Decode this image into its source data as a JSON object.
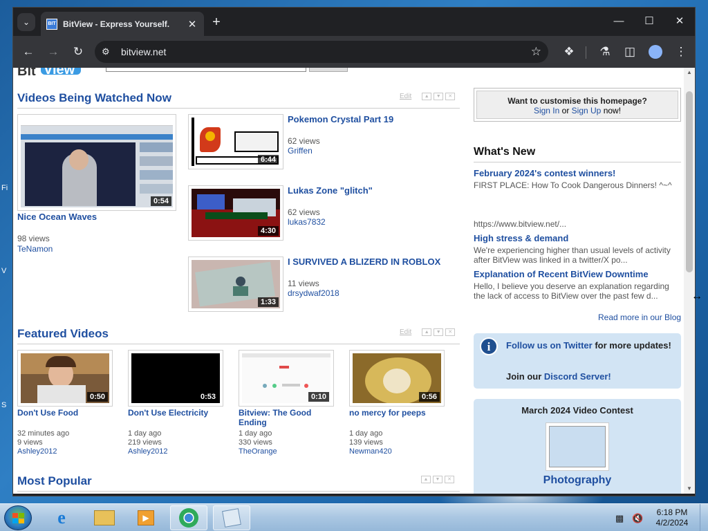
{
  "browser": {
    "tab_title": "BitView - Express Yourself.",
    "favicon_text": "BIT VIEW",
    "url": "bitview.net"
  },
  "icons": {
    "tab_search": "chevron-down-icon",
    "tab_close": "close-icon",
    "new_tab": "plus-icon",
    "minimize": "minimize-icon",
    "maximize": "maximize-icon",
    "close": "close-icon",
    "back": "arrow-left-icon",
    "forward": "arrow-right-icon",
    "reload": "reload-icon",
    "site_info": "tune-icon",
    "bookmark": "star-icon",
    "extensions": "puzzle-icon",
    "labs": "flask-icon",
    "side_panel": "side-panel-icon",
    "profile": "profile-icon",
    "menu": "kebab-menu-icon"
  },
  "header": {
    "logo_bit": "Bit",
    "logo_view": "View"
  },
  "watched": {
    "title": "Videos Being Watched Now",
    "edit": "Edit",
    "featured": {
      "title": "Nice Ocean Waves",
      "duration": "0:54",
      "views": "98 views",
      "user": "TeNamon"
    },
    "list": [
      {
        "title": "Pokemon Crystal Part 19",
        "duration": "6:44",
        "views": "62 views",
        "user": "Griffen"
      },
      {
        "title": "Lukas Zone \"glitch\"",
        "duration": "4:30",
        "views": "62 views",
        "user": "lukas7832"
      },
      {
        "title": "I SURVIVED A BLIZERD IN ROBLOX",
        "duration": "1:33",
        "views": "11 views",
        "user": "drsydwaf2018"
      }
    ]
  },
  "featured_videos": {
    "title": "Featured Videos",
    "edit": "Edit",
    "items": [
      {
        "title": "Don't Use Food",
        "duration": "0:50",
        "time": "32 minutes ago",
        "views": "9 views",
        "user": "Ashley2012"
      },
      {
        "title": "Don't Use Electricity",
        "duration": "0:53",
        "time": "1 day ago",
        "views": "219 views",
        "user": "Ashley2012"
      },
      {
        "title": "Bitview: The Good Ending",
        "duration": "0:10",
        "time": "1 day ago",
        "views": "330 views",
        "user": "TheOrange"
      },
      {
        "title": "no mercy for peeps",
        "duration": "0:56",
        "time": "1 day ago",
        "views": "139 views",
        "user": "Newman420"
      }
    ]
  },
  "most_popular": {
    "title": "Most Popular"
  },
  "sidebar": {
    "customise_question": "Want to customise this homepage?",
    "sign_in": "Sign In",
    "or": "or",
    "sign_up": "Sign Up",
    "now": "now!",
    "whats_new": "What's New",
    "news": [
      {
        "title": "February 2024's contest winners!",
        "body": "FIRST PLACE: How To Cook Dangerous Dinners! ^~^"
      },
      {
        "title": "High stress & demand",
        "body": "We're experiencing higher than usual levels of activity after BitView was linked in a twitter/X po..."
      },
      {
        "title": "Explanation of Recent BitView Downtime",
        "body": "Hello, I believe you deserve an explanation regarding the lack of access to BitView over the past few d..."
      }
    ],
    "news_url": "https://www.bitview.net/...",
    "read_more": "Read more in our Blog",
    "twitter_link": "Follow us on Twitter",
    "twitter_rest": "for more updates!",
    "discord_prefix": "Join our",
    "discord_link": "Discord Server!",
    "contest_title": "March 2024 Video Contest",
    "contest_caption": "Photography"
  },
  "desktop": {
    "edge_letters": [
      "Fi",
      "V",
      "S"
    ]
  },
  "taskbar": {
    "time": "6:18 PM",
    "date": "4/2/2024"
  },
  "colors": {
    "link_blue": "#1f4fa0",
    "browser_dark": "#202124",
    "browser_toolbar": "#35363a",
    "info_box": "#d2e4f4"
  }
}
